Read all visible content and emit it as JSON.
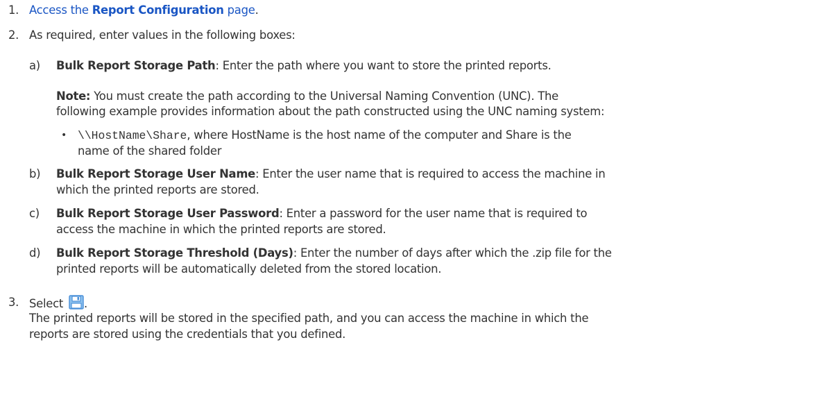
{
  "steps": {
    "s1": {
      "num": "1.",
      "pre": "Access the ",
      "bold": "Report Configuration",
      "post": " page",
      "end": "."
    },
    "s2": {
      "num": "2.",
      "text": "As required, enter values in the following boxes:",
      "a": {
        "label": "a)",
        "term": "Bulk Report Storage Path",
        "desc": ": Enter the path where you want to store the printed reports.",
        "note_label": "Note:",
        "note_line1": " You must create the path according to the Universal Naming Convention (UNC). The",
        "note_line2": "following example provides information about the path constructed using the UNC naming system:",
        "bullet": "•",
        "code": "\\\\HostName\\Share",
        "bullet_line1": ", where HostName is the host name of the computer and Share is the",
        "bullet_line2": "name of the shared folder"
      },
      "b": {
        "label": "b)",
        "term": "Bulk Report Storage User Name",
        "line1": ": Enter the user name that is required to access the machine in",
        "line2": "which the printed reports are stored."
      },
      "c": {
        "label": "c)",
        "term": "Bulk Report Storage User Password",
        "line1": ": Enter a password for the user name that is required to",
        "line2": "access the machine in which the printed reports are stored."
      },
      "d": {
        "label": "d)",
        "term": "Bulk Report Storage Threshold (Days)",
        "line1": ": Enter the number of days after which the .zip file for the",
        "line2": "printed reports will be automatically deleted from the stored location."
      }
    },
    "s3": {
      "num": "3.",
      "pre": "Select ",
      "end": ".",
      "icon": "save-icon",
      "result_line1": "The printed reports will be stored in the specified path, and you can access the machine in which the",
      "result_line2": "reports are stored using the credentials that you defined."
    }
  },
  "colors": {
    "link": "#1a56c4",
    "text": "#333333",
    "icon": "#4a90d9"
  }
}
